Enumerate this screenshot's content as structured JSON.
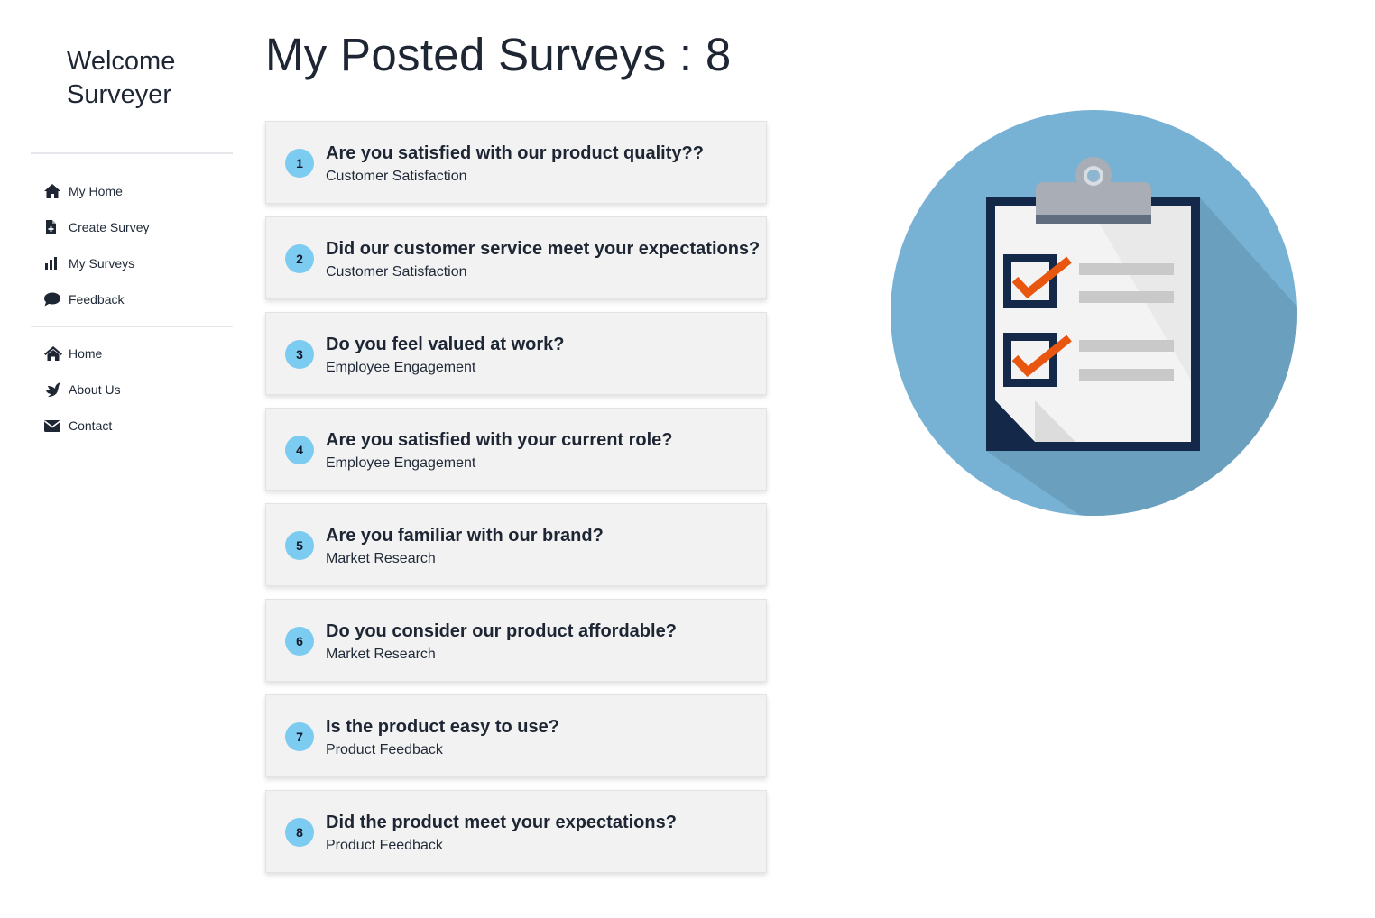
{
  "sidebar": {
    "welcome": "Welcome\nSurveyer",
    "primary_nav": [
      {
        "label": "My Home",
        "icon": "home-icon"
      },
      {
        "label": "Create Survey",
        "icon": "file-plus-icon"
      },
      {
        "label": "My Surveys",
        "icon": "bar-chart-icon"
      },
      {
        "label": "Feedback",
        "icon": "comment-icon"
      }
    ],
    "secondary_nav": [
      {
        "label": "Home",
        "icon": "house-icon"
      },
      {
        "label": "About Us",
        "icon": "dove-icon"
      },
      {
        "label": "Contact",
        "icon": "envelope-icon"
      }
    ]
  },
  "main": {
    "title": "My Posted Surveys : 8",
    "surveys": [
      {
        "number": "1",
        "question": "Are you satisfied with our product quality??",
        "category": "Customer Satisfaction"
      },
      {
        "number": "2",
        "question": "Did our customer service meet your expectations?",
        "category": "Customer Satisfaction"
      },
      {
        "number": "3",
        "question": "Do you feel valued at work?",
        "category": "Employee Engagement"
      },
      {
        "number": "4",
        "question": "Are you satisfied with your current role?",
        "category": "Employee Engagement"
      },
      {
        "number": "5",
        "question": "Are you familiar with our brand?",
        "category": "Market Research"
      },
      {
        "number": "6",
        "question": "Do you consider our product affordable?",
        "category": "Market Research"
      },
      {
        "number": "7",
        "question": "Is the product easy to use?",
        "category": "Product Feedback"
      },
      {
        "number": "8",
        "question": "Did the product meet your expectations?",
        "category": "Product Feedback"
      }
    ]
  },
  "colors": {
    "badge": "#7ccbf0",
    "card_bg": "#f2f2f2",
    "illustration_circle": "#77b2d4",
    "clipboard_frame": "#14284a",
    "check": "#e8560f"
  },
  "illustration": {
    "icon": "clipboard-checklist-icon"
  }
}
